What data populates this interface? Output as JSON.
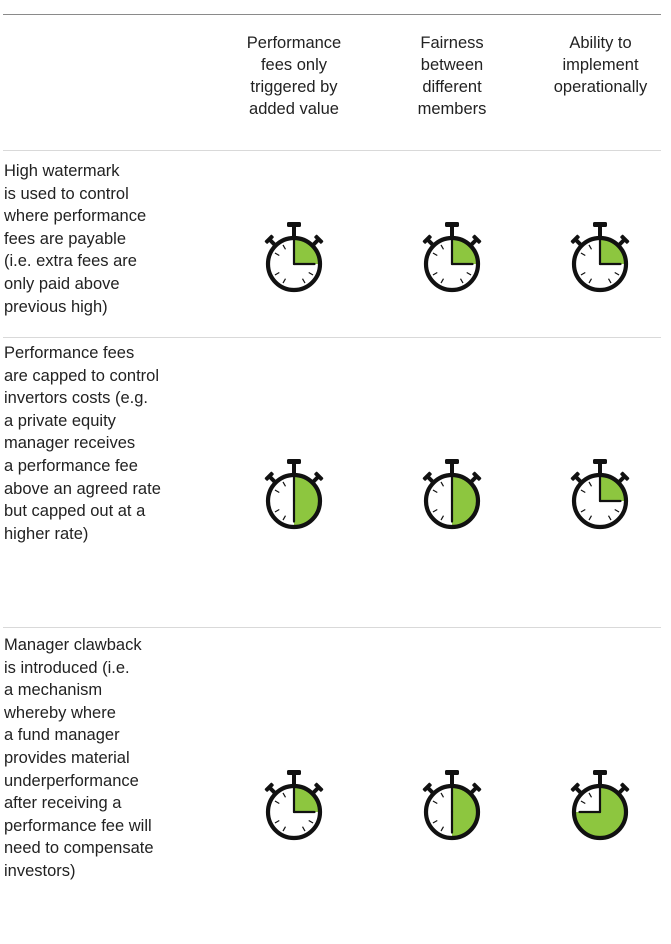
{
  "columns": [
    {
      "lines": [
        "Performance",
        "fees only",
        "triggered by",
        "added value"
      ]
    },
    {
      "lines": [
        "Fairness",
        "between",
        "different",
        "members"
      ]
    },
    {
      "lines": [
        "Ability to",
        "implement",
        "operationally"
      ]
    }
  ],
  "rows": [
    {
      "lines": [
        "High watermark",
        "is used to control",
        "where performance",
        "fees are payable",
        "(i.e. extra fees are",
        "only paid above",
        "previous high)"
      ],
      "ratings": [
        0.25,
        0.25,
        0.25
      ]
    },
    {
      "lines": [
        "Performance fees",
        "are capped to control",
        "invertors costs (e.g.",
        "a private equity",
        "manager receives",
        "a performance fee",
        "above an agreed rate",
        "but capped out at a",
        "higher rate)"
      ],
      "ratings": [
        0.5,
        0.5,
        0.25
      ]
    },
    {
      "lines": [
        "Manager clawback",
        "is introduced (i.e.",
        "a mechanism",
        "whereby where",
        "a fund manager",
        "provides material",
        "underperformance",
        "after receiving a",
        "performance fee will",
        "need to compensate",
        "investors)"
      ],
      "ratings": [
        0.25,
        0.5,
        0.75
      ]
    }
  ],
  "colors": {
    "fill": "#8dc63f",
    "outline": "#111111",
    "rule": "#d9d9d9"
  },
  "icons": {
    "rating": "stopwatch-icon"
  }
}
